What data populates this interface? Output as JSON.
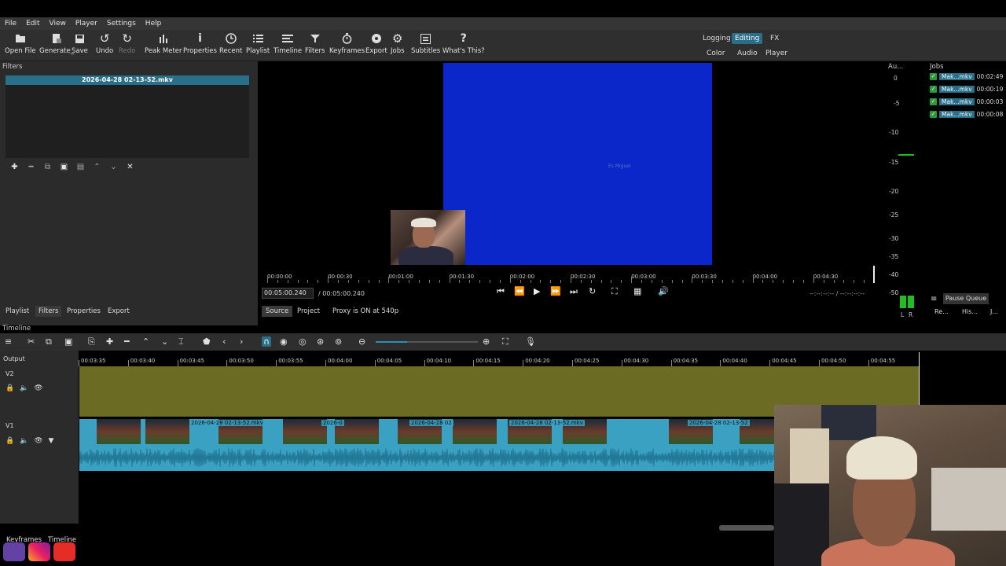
{
  "menu": [
    "File",
    "Edit",
    "View",
    "Player",
    "Settings",
    "Help"
  ],
  "toolbar": {
    "open_file": "Open File",
    "generate": "Generate_",
    "save": "Save",
    "undo": "Undo",
    "redo": "Redo",
    "peak_meter": "Peak Meter",
    "properties": "Properties",
    "recent": "Recent",
    "playlist": "Playlist",
    "timeline": "Timeline",
    "filters": "Filters",
    "keyframes": "Keyframes",
    "export": "Export",
    "jobs": "Jobs",
    "subtitles": "Subtitles",
    "whats_this": "What's This?"
  },
  "layouts": {
    "logging": "Logging",
    "editing": "Editing",
    "fx": "FX",
    "color": "Color",
    "audio": "Audio",
    "player": "Player"
  },
  "filters": {
    "title": "Filters",
    "clip_name": "2026-04-28 02-13-52.mkv"
  },
  "left_tabs": [
    "Playlist",
    "Filters",
    "Properties",
    "Export"
  ],
  "preview": {
    "caption": "Es Miguel"
  },
  "player": {
    "ruler_labels": [
      "00:00:00",
      "00:00:30",
      "00:01:00",
      "00:01:30",
      "00:02:00",
      "00:02:30",
      "00:03:00",
      "00:03:30",
      "00:04:00",
      "00:04:30"
    ],
    "position": "00:05:00.240",
    "duration": "/  00:05:00.240",
    "in_out": "--:--:--:--  /  --:--:--:--",
    "source_tab": "Source",
    "project_tab": "Project",
    "proxy_status": "Proxy is ON at 540p"
  },
  "audio_meter": {
    "title": "Au...",
    "scale": [
      "0",
      "-5",
      "-10",
      "-15",
      "-20",
      "-25",
      "-30",
      "-35",
      "-40",
      "-50"
    ],
    "left": "L",
    "right": "R"
  },
  "jobs": {
    "title": "Jobs",
    "items": [
      {
        "name": "Mak...mkv",
        "time": "00:02:49"
      },
      {
        "name": "Mak...mkv",
        "time": "00:00:19"
      },
      {
        "name": "Mak...mkv",
        "time": "00:00:03"
      },
      {
        "name": "Mak...mkv",
        "time": "00:00:08"
      }
    ],
    "pause_queue": "Pause Queue",
    "recent_tab": "Re...",
    "history_tab": "His...",
    "j_tab": "J..."
  },
  "timeline": {
    "title": "Timeline",
    "output_label": "Output",
    "ruler_labels": [
      "00:03:35",
      "00:03:40",
      "00:03:45",
      "00:03:50",
      "00:03:55",
      "00:04:00",
      "00:04:05",
      "00:04:10",
      "00:04:15",
      "00:04:20",
      "00:04:25",
      "00:04:30",
      "00:04:35",
      "00:04:40",
      "00:04:45",
      "00:04:50",
      "00:04:55"
    ],
    "tracks": {
      "v2": "V2",
      "v1": "V1"
    },
    "clip_labels": [
      "2026-04-28 02-13-52.mkv",
      "2026-0",
      "2026-04-28 02",
      "2026-04-28 02-13-52.mkv",
      "2026-04-28 02-13-52"
    ]
  },
  "bottom_tabs": [
    "Keyframes",
    "Timeline"
  ],
  "colors": {
    "accent": "#2a6f8a",
    "v2_track": "#6b6b23",
    "v1_clip": "#3aa1c2",
    "preview_blue": "#0b26c9"
  }
}
